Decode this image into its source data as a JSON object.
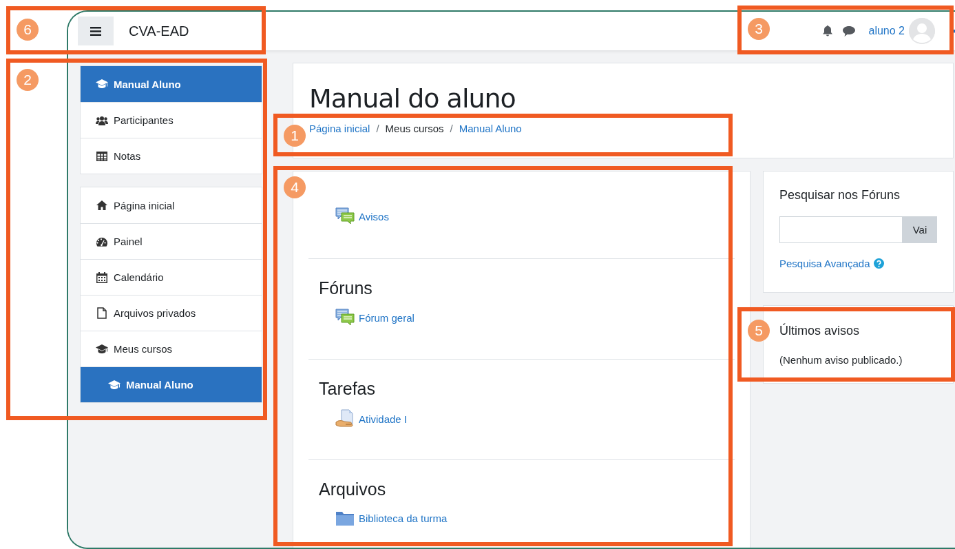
{
  "header": {
    "site_name": "CVA-EAD",
    "user_name": "aluno 2"
  },
  "nav_groups": [
    {
      "items": [
        {
          "label": "Manual Aluno",
          "kind": "graduation",
          "selected": true
        },
        {
          "label": "Participantes",
          "kind": "users",
          "selected": false
        },
        {
          "label": "Notas",
          "kind": "table",
          "selected": false
        }
      ]
    },
    {
      "items": [
        {
          "label": "Página inicial",
          "kind": "home",
          "selected": false
        },
        {
          "label": "Painel",
          "kind": "gauge",
          "selected": false
        },
        {
          "label": "Calendário",
          "kind": "calendar",
          "selected": false
        },
        {
          "label": "Arquivos privados",
          "kind": "file",
          "selected": false
        },
        {
          "label": "Meus cursos",
          "kind": "graduation",
          "selected": false,
          "children": [
            {
              "label": "Manual Aluno",
              "kind": "graduation",
              "selected": true
            }
          ]
        }
      ]
    }
  ],
  "page_header": {
    "title": "Manual do aluno",
    "breadcrumb": [
      {
        "label": "Página inicial",
        "kind": "link"
      },
      {
        "label": "Meus cursos",
        "kind": "text",
        "separator": "/"
      },
      {
        "label": "Manual Aluno",
        "kind": "link",
        "separator": "/"
      }
    ]
  },
  "sections": [
    {
      "activities": [
        {
          "label": "Avisos",
          "kind": "forum"
        }
      ]
    },
    {
      "title": "Fóruns",
      "activities": [
        {
          "label": "Fórum geral",
          "kind": "forum"
        }
      ]
    },
    {
      "title": "Tarefas",
      "activities": [
        {
          "label": "Atividade I",
          "kind": "assignment"
        }
      ]
    },
    {
      "title": "Arquivos",
      "activities": [
        {
          "label": "Biblioteca da turma",
          "kind": "folder"
        }
      ]
    }
  ],
  "search_block": {
    "title": "Pesquisar nos Fóruns",
    "button": "Vai",
    "link": "Pesquisa Avançada"
  },
  "news_block": {
    "title": "Últimos avisos",
    "text": "(Nenhum aviso publicado.)"
  },
  "annotations": [
    {
      "number": "6"
    },
    {
      "number": "3"
    },
    {
      "number": "2"
    },
    {
      "number": "1"
    },
    {
      "number": "4"
    },
    {
      "number": "5"
    }
  ]
}
